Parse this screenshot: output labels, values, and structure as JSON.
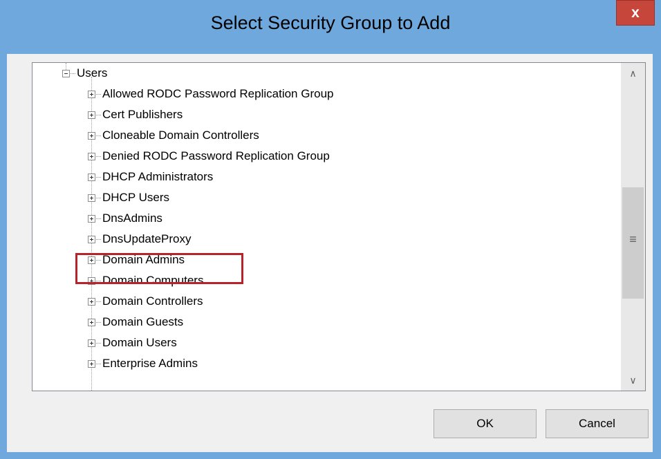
{
  "window": {
    "title": "Select Security Group to Add",
    "close_label": "x"
  },
  "tree": {
    "root": {
      "label": "Users",
      "expanded": true
    },
    "items": [
      {
        "label": "Allowed RODC Password Replication Group"
      },
      {
        "label": "Cert Publishers"
      },
      {
        "label": "Cloneable Domain Controllers"
      },
      {
        "label": "Denied RODC Password Replication Group"
      },
      {
        "label": "DHCP Administrators"
      },
      {
        "label": "DHCP Users"
      },
      {
        "label": "DnsAdmins"
      },
      {
        "label": "DnsUpdateProxy"
      },
      {
        "label": "Domain Admins",
        "highlighted": true
      },
      {
        "label": "Domain Computers"
      },
      {
        "label": "Domain Controllers"
      },
      {
        "label": "Domain Guests"
      },
      {
        "label": "Domain Users"
      },
      {
        "label": "Enterprise Admins"
      }
    ]
  },
  "scrollbar": {
    "up_icon": "chevron-up-icon",
    "down_icon": "chevron-down-icon",
    "grip_icon": "grip-icon"
  },
  "buttons": {
    "ok": "OK",
    "cancel": "Cancel"
  },
  "colors": {
    "title_bar": "#6ea8dc",
    "close_button": "#c7463c",
    "highlight_box": "#b8232b"
  }
}
